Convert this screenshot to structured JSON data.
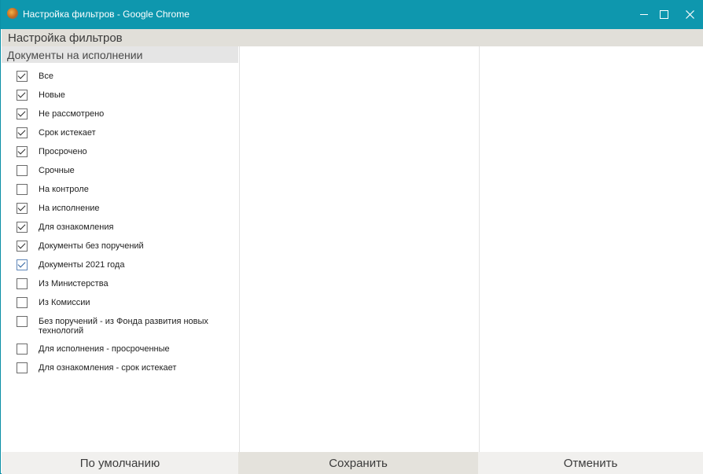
{
  "window": {
    "title": "Настройка фильтров - Google Chrome",
    "controls": [
      "minimize-icon",
      "maximize-icon",
      "close-icon"
    ]
  },
  "header": {
    "title": "Настройка фильтров"
  },
  "filters_panel": {
    "heading": "Документы на исполнении",
    "items": [
      {
        "label": "Все",
        "checked": true
      },
      {
        "label": "Новые",
        "checked": true
      },
      {
        "label": "Не рассмотрено",
        "checked": true
      },
      {
        "label": "Срок истекает",
        "checked": true
      },
      {
        "label": "Просрочено",
        "checked": true
      },
      {
        "label": "Срочные",
        "checked": false
      },
      {
        "label": "На контроле",
        "checked": false
      },
      {
        "label": "На исполнение",
        "checked": true
      },
      {
        "label": "Для ознакомления",
        "checked": true
      },
      {
        "label": "Документы без поручений",
        "checked": true
      },
      {
        "label": "Документы 2021 года",
        "checked": true
      },
      {
        "label": "Из Министерства",
        "checked": false
      },
      {
        "label": "Из Комиссии",
        "checked": false
      },
      {
        "label": "Без поручений - из Фонда развития новых технологий",
        "checked": false
      },
      {
        "label": "Для исполнения - просроченные",
        "checked": false
      },
      {
        "label": "Для ознакомления - срок истекает",
        "checked": false
      }
    ]
  },
  "buttons": {
    "default_label": "По умолчанию",
    "save_label": "Сохранить",
    "cancel_label": "Отменить"
  },
  "colors": {
    "titlebar": "#0e97ae",
    "header": "#e1dfd9",
    "column_header": "#e5e5e5",
    "save_button": "#e4e2dc"
  }
}
